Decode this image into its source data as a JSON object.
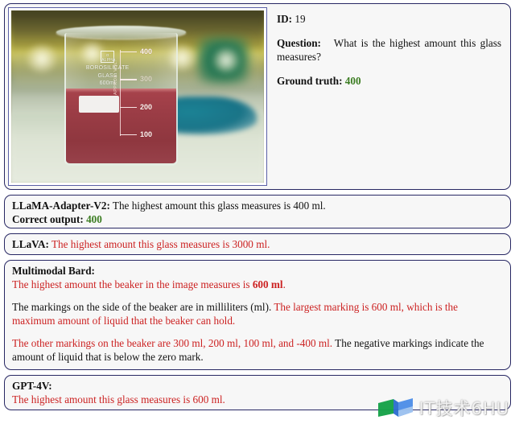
{
  "header": {
    "id_label": "ID:",
    "id_value": "19",
    "question_label": "Question:",
    "question_text": "What is the highest amount this glass measures?",
    "ground_truth_label": "Ground truth:",
    "ground_truth_value": "400"
  },
  "figure": {
    "alt": "photograph of a borosilicate glass beaker containing red liquid",
    "beaker_brand": "ALPHA",
    "beaker_text_line1": "BOROSILICATE",
    "beaker_text_line2": "GLASS",
    "beaker_text_line3": "600ml",
    "approx_vol_label": "APPROX. VOL.",
    "tick_labels": [
      "400",
      "300",
      "200",
      "100"
    ]
  },
  "responses": [
    {
      "model": "LLaMA-Adapter-V2:",
      "text": "The highest amount this glass measures is 400 ml.",
      "extra_label": "Correct output:",
      "extra_value": "400",
      "color": "black"
    },
    {
      "model": "LLaVA:",
      "text": "The highest amount this glass measures is 3000 ml.",
      "color": "red"
    },
    {
      "model": "Multimodal Bard:",
      "line1": "The highest amount the beaker in the image measures is ",
      "line1_bold": "600 ml",
      "line1_end": ".",
      "para2_black": "The markings on the side of the beaker are in milliliters (ml). ",
      "para2_red": "The largest marking is 600 ml, which is the maximum amount of liquid that the beaker can hold.",
      "para3_red": "The other markings on the beaker are 300 ml, 200 ml, 100 ml, and -400 ml.",
      "para3_black": " The negative markings indicate the amount of liquid that is below the zero mark."
    },
    {
      "model": "GPT-4V:",
      "text": "The highest amount this glass measures is 600 ml.",
      "color": "red"
    }
  ],
  "watermark": {
    "text": "IT技术6HU",
    "logo_name": "book-logo"
  },
  "colors": {
    "panel_border": "#272763",
    "panel_background": "#f7f7f7",
    "correct_green": "#3c7d22",
    "error_red": "#cc2222"
  }
}
